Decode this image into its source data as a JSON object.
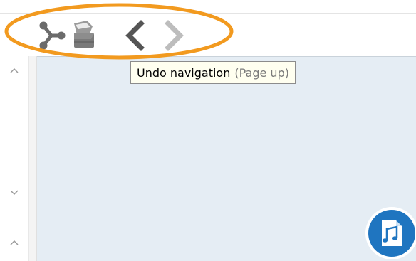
{
  "toolbar": {
    "buttons": [
      {
        "icon": "share-node-icon",
        "enabled": true
      },
      {
        "icon": "bucket-icon",
        "enabled": true
      },
      {
        "icon": "back-arrow-icon",
        "enabled": true
      },
      {
        "icon": "forward-arrow-icon",
        "enabled": false
      }
    ]
  },
  "tooltip": {
    "label": "Undo navigation",
    "shortcut": "(Page up)"
  },
  "gutter": {
    "arrows": [
      "chevron-up-icon",
      "chevron-down-icon",
      "chevron-up-icon"
    ]
  },
  "badge": {
    "icon": "music-file-icon"
  },
  "colors": {
    "highlight": "#f29a1f",
    "pane": "#e5edf4",
    "icon_active": "#555555",
    "icon_disabled": "#bdbdbd",
    "badge": "#1f75c0"
  }
}
